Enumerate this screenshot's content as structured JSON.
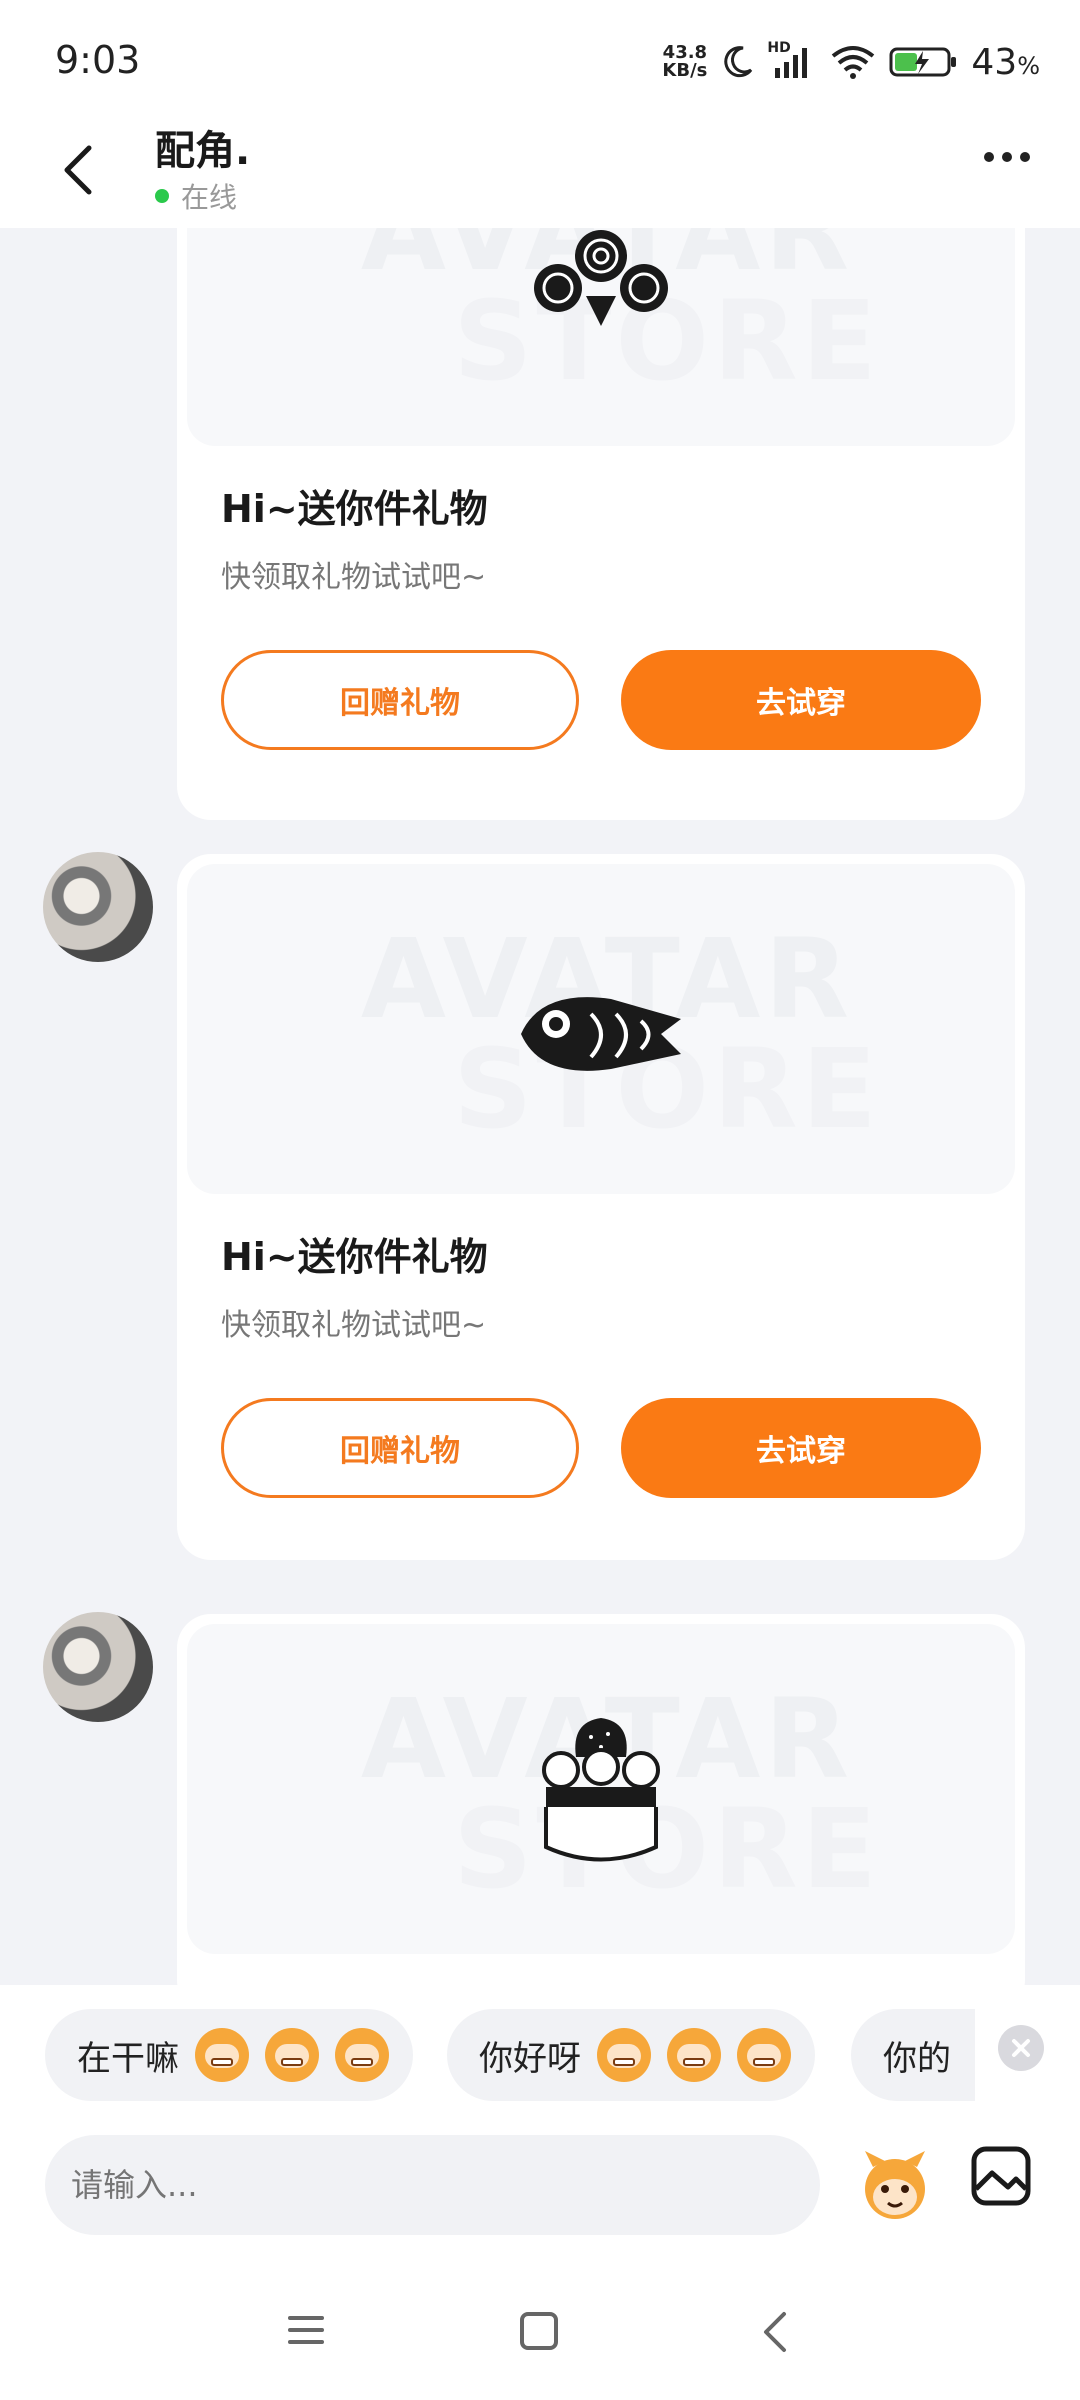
{
  "status_bar": {
    "time": "9:03",
    "net_speed_value": "43.8",
    "net_speed_unit": "KB/s",
    "signal_label": "HD",
    "battery_percent": "43",
    "battery_unit": "%"
  },
  "header": {
    "contact_name": "配角.",
    "status": "在线",
    "back_icon": "chevron-left-icon",
    "more_icon": "more-dots-icon"
  },
  "messages": [
    {
      "title": "Hi~送你件礼物",
      "subtitle": "快领取礼物试试吧~",
      "return_gift_label": "回赠礼物",
      "try_on_label": "去试穿",
      "watermark_line1": "AVATAR",
      "watermark_line2": "STORE",
      "gift_icon": "rose-bouquet-icon"
    },
    {
      "title": "Hi~送你件礼物",
      "subtitle": "快领取礼物试试吧~",
      "return_gift_label": "回赠礼物",
      "try_on_label": "去试穿",
      "watermark_line1": "AVATAR",
      "watermark_line2": "STORE",
      "gift_icon": "koi-fish-icon"
    },
    {
      "watermark_line1": "AVATAR",
      "watermark_line2": "STORE",
      "gift_icon": "cake-icon"
    }
  ],
  "quick_replies": [
    {
      "text": "在干嘛",
      "emoji": "grin-monkey-emoji"
    },
    {
      "text": "你好呀",
      "emoji": "smile-monkey-emoji"
    },
    {
      "text": "你的"
    }
  ],
  "input": {
    "placeholder": "请输入..."
  },
  "colors": {
    "accent": "#fa7a14",
    "online": "#2ac94b",
    "background": "#f2f3f7"
  }
}
